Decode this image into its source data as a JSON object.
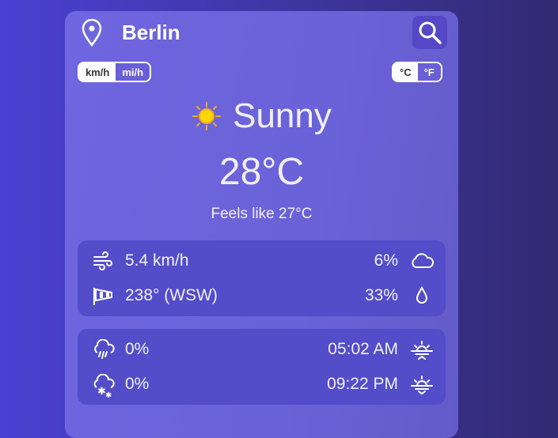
{
  "location": {
    "city": "Berlin",
    "icon": "map-pin-icon"
  },
  "search": {
    "icon": "search-icon"
  },
  "speed_units": {
    "options": [
      "km/h",
      "mi/h"
    ],
    "selected": "km/h"
  },
  "temp_units": {
    "options": [
      "°C",
      "°F"
    ],
    "selected": "°C"
  },
  "current": {
    "condition": "Sunny",
    "icon": "sun-icon",
    "temperature": "28°C",
    "feels_like": "Feels like 27°C"
  },
  "details": {
    "wind_speed": "5.4 km/h",
    "wind_direction": "238° (WSW)",
    "cloudiness": "6%",
    "humidity": "33%",
    "rain_chance": "0%",
    "snow_chance": "0%",
    "sunrise": "05:02 AM",
    "sunset": "09:22 PM"
  },
  "colors": {
    "card": "#6c63dd",
    "panel": "#534dc9",
    "sun": "#ffd700"
  }
}
